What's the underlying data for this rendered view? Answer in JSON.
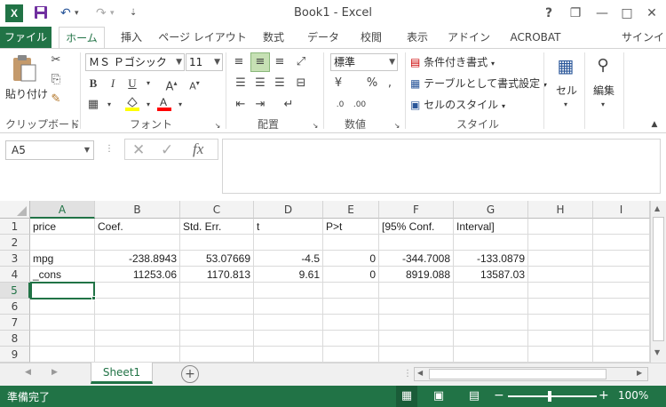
{
  "window": {
    "title": "Book1 - Excel",
    "help": "?",
    "minimize": "—",
    "restore": "❐",
    "close": "✕"
  },
  "tabs": [
    "ファイル",
    "ホーム",
    "挿入",
    "ページ レイアウト",
    "数式",
    "データ",
    "校閲",
    "表示",
    "アドイン",
    "ACROBAT",
    "サインイン"
  ],
  "ribbon": {
    "paste": "貼り付け",
    "clipboard": "クリップボード",
    "font_name": "ＭＳ Ｐゴシック",
    "font_size": "11",
    "font": "フォント",
    "align": "配置",
    "number_format": "標準",
    "number": "数値",
    "cond_format": "条件付き書式",
    "table_format": "テーブルとして書式設定",
    "cell_style": "セルのスタイル",
    "style": "スタイル",
    "cells": "セル",
    "edit": "編集",
    "bold": "B",
    "italic": "I",
    "underline": "U"
  },
  "formula_bar": {
    "name_box": "A5",
    "fx": "fx",
    "formula": ""
  },
  "sheet": {
    "columns": [
      "A",
      "B",
      "C",
      "D",
      "E",
      "F",
      "G",
      "H",
      "I"
    ],
    "rows": [
      "1",
      "2",
      "3",
      "4",
      "5",
      "6",
      "7",
      "8",
      "9"
    ],
    "cells": [
      [
        "price",
        "Coef.",
        "Std. Err.",
        "t",
        "P>t",
        "[95% Conf.",
        "Interval]"
      ],
      [
        "",
        "",
        "",
        "",
        "",
        "",
        ""
      ],
      [
        "mpg",
        "-238.8943",
        "53.07669",
        "-4.5",
        "0",
        "-344.7008",
        "-133.0879"
      ],
      [
        "_cons",
        "11253.06",
        "1170.813",
        "9.61",
        "0",
        "8919.088",
        "13587.03"
      ]
    ]
  },
  "sheet_tab": "Sheet1",
  "status": {
    "ready": "準備完了",
    "zoom": "100%"
  }
}
